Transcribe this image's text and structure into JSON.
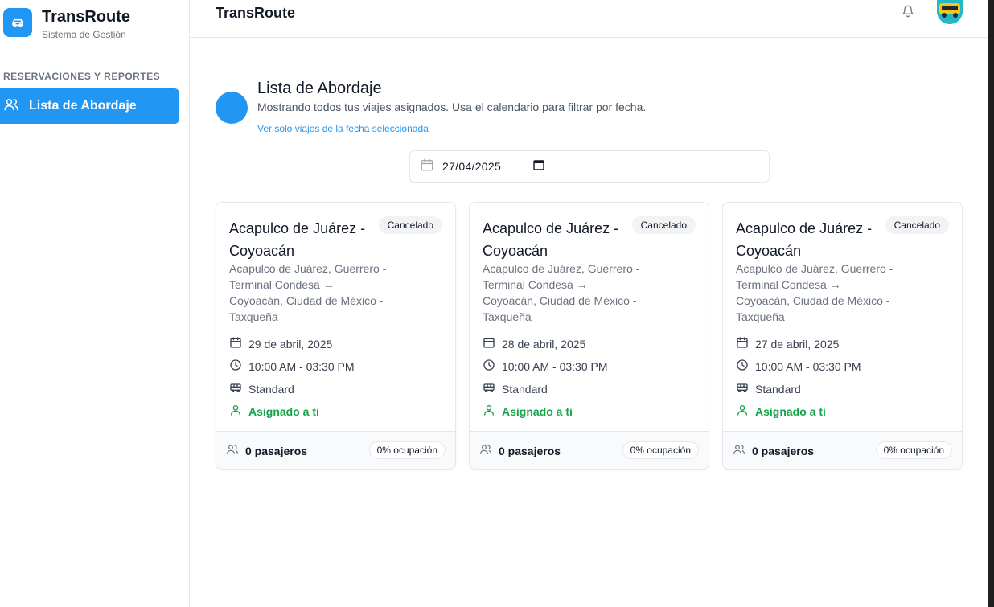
{
  "brand": {
    "title": "TransRoute",
    "subtitle": "Sistema de Gestión"
  },
  "sidebar": {
    "section_label": "RESERVACIONES Y REPORTES",
    "items": [
      {
        "label": "Lista de Abordaje",
        "icon": "users-icon",
        "active": true
      }
    ]
  },
  "topbar": {
    "title": "TransRoute",
    "icons": [
      "bell-icon",
      "avatar"
    ]
  },
  "header": {
    "title": "Lista de Abordaje",
    "description": "Mostrando todos tus viajes asignados. Usa el calendario para filtrar por fecha.",
    "link": "Ver solo viajes de la fecha seleccionada"
  },
  "date_filter": {
    "value": "27/04/2025"
  },
  "colors": {
    "accent": "#2196f3",
    "success": "#16a34a",
    "border": "#e5e7eb"
  },
  "cards": [
    {
      "title": "Acapulco de Juárez - Coyoacán",
      "status": "Cancelado",
      "route": "Acapulco de Juárez, Guerrero - Terminal Condesa → Coyoacán, Ciudad de México - Taxqueña",
      "date": "29 de abril, 2025",
      "time": "10:00 AM - 03:30 PM",
      "vehicle": "Standard",
      "assigned": "Asignado a ti",
      "passengers": "0 pasajeros",
      "occupancy": "0% ocupación"
    },
    {
      "title": "Acapulco de Juárez - Coyoacán",
      "status": "Cancelado",
      "route": "Acapulco de Juárez, Guerrero - Terminal Condesa → Coyoacán, Ciudad de México - Taxqueña",
      "date": "28 de abril, 2025",
      "time": "10:00 AM - 03:30 PM",
      "vehicle": "Standard",
      "assigned": "Asignado a ti",
      "passengers": "0 pasajeros",
      "occupancy": "0% ocupación"
    },
    {
      "title": "Acapulco de Juárez - Coyoacán",
      "status": "Cancelado",
      "route": "Acapulco de Juárez, Guerrero - Terminal Condesa → Coyoacán, Ciudad de México - Taxqueña",
      "date": "27 de abril, 2025",
      "time": "10:00 AM - 03:30 PM",
      "vehicle": "Standard",
      "assigned": "Asignado a ti",
      "passengers": "0 pasajeros",
      "occupancy": "0% ocupación"
    }
  ]
}
